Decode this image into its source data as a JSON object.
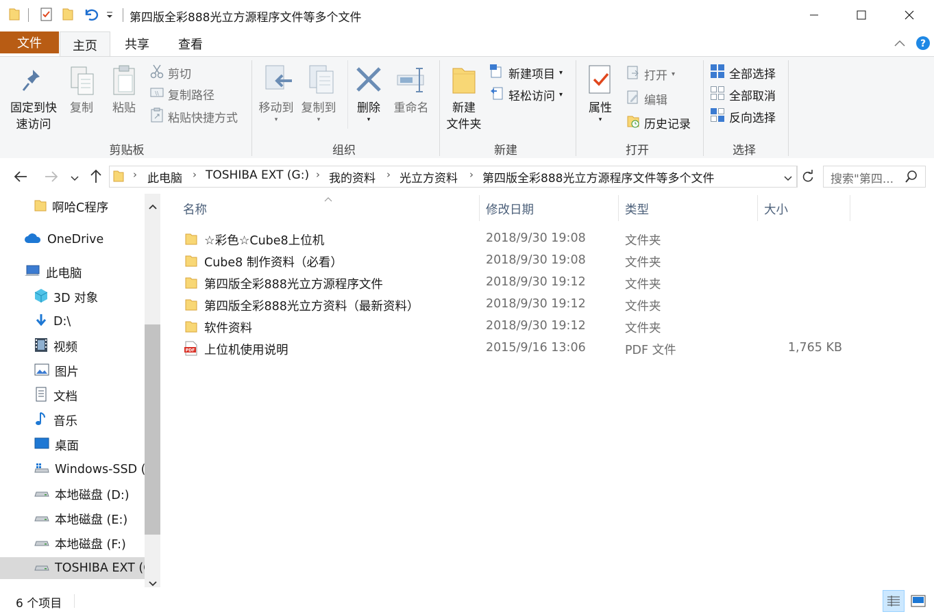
{
  "window": {
    "title": "第四版全彩888光立方源程序文件等多个文件"
  },
  "tabs": {
    "file": "文件",
    "home": "主页",
    "share": "共享",
    "view": "查看"
  },
  "ribbon": {
    "clipboard": {
      "pin_label_1": "固定到快",
      "pin_label_2": "速访问",
      "copy": "复制",
      "paste": "粘贴",
      "cut": "剪切",
      "copy_path": "复制路径",
      "paste_shortcut": "粘贴快捷方式",
      "group": "剪贴板"
    },
    "organize": {
      "move_to": "移动到",
      "copy_to": "复制到",
      "delete": "删除",
      "rename": "重命名",
      "group": "组织"
    },
    "new": {
      "new_folder_1": "新建",
      "new_folder_2": "文件夹",
      "new_item": "新建项目",
      "easy_access": "轻松访问",
      "group": "新建"
    },
    "open": {
      "properties": "属性",
      "open": "打开",
      "edit": "编辑",
      "history": "历史记录",
      "group": "打开"
    },
    "select": {
      "select_all": "全部选择",
      "select_none": "全部取消",
      "invert": "反向选择",
      "group": "选择"
    }
  },
  "address": {
    "crumbs": [
      "此电脑",
      "TOSHIBA EXT (G:)",
      "我的资料",
      "光立方资料",
      "第四版全彩888光立方源程序文件等多个文件"
    ],
    "search_placeholder": "搜索\"第四..."
  },
  "nav": {
    "items": [
      {
        "label": "啊哈C程序",
        "icon": "folder-icon"
      },
      {
        "label": "OneDrive",
        "icon": "cloud-icon"
      },
      {
        "label": "此电脑",
        "icon": "computer-icon"
      },
      {
        "label": "3D 对象",
        "icon": "cube-icon"
      },
      {
        "label": "D:\\",
        "icon": "download-icon"
      },
      {
        "label": "视频",
        "icon": "video-icon"
      },
      {
        "label": "图片",
        "icon": "pictures-icon"
      },
      {
        "label": "文档",
        "icon": "documents-icon"
      },
      {
        "label": "音乐",
        "icon": "music-icon"
      },
      {
        "label": "桌面",
        "icon": "desktop-icon"
      },
      {
        "label": "Windows-SSD (",
        "icon": "drive-icon"
      },
      {
        "label": "本地磁盘 (D:)",
        "icon": "drive-icon"
      },
      {
        "label": "本地磁盘 (E:)",
        "icon": "drive-icon"
      },
      {
        "label": "本地磁盘 (F:)",
        "icon": "drive-icon"
      },
      {
        "label": "TOSHIBA EXT (G",
        "icon": "drive-icon"
      }
    ]
  },
  "columns": {
    "name": "名称",
    "date": "修改日期",
    "type": "类型",
    "size": "大小"
  },
  "files": [
    {
      "name": "☆彩色☆Cube8上位机",
      "date": "2018/9/30 19:08",
      "type": "文件夹",
      "size": "",
      "icon": "folder-icon"
    },
    {
      "name": "Cube8 制作资料（必看）",
      "date": "2018/9/30 19:08",
      "type": "文件夹",
      "size": "",
      "icon": "folder-icon"
    },
    {
      "name": "第四版全彩888光立方源程序文件",
      "date": "2018/9/30 19:12",
      "type": "文件夹",
      "size": "",
      "icon": "folder-icon"
    },
    {
      "name": "第四版全彩888光立方资料（最新资料）",
      "date": "2018/9/30 19:12",
      "type": "文件夹",
      "size": "",
      "icon": "folder-icon"
    },
    {
      "name": "软件资料",
      "date": "2018/9/30 19:12",
      "type": "文件夹",
      "size": "",
      "icon": "folder-icon"
    },
    {
      "name": "上位机使用说明",
      "date": "2015/9/16 13:06",
      "type": "PDF 文件",
      "size": "1,765 KB",
      "icon": "pdf-icon"
    }
  ],
  "status": {
    "count": "6 个项目"
  },
  "colors": {
    "file_tab": "#b85c14",
    "folder": "#f8d775",
    "accent": "#0078d7"
  }
}
